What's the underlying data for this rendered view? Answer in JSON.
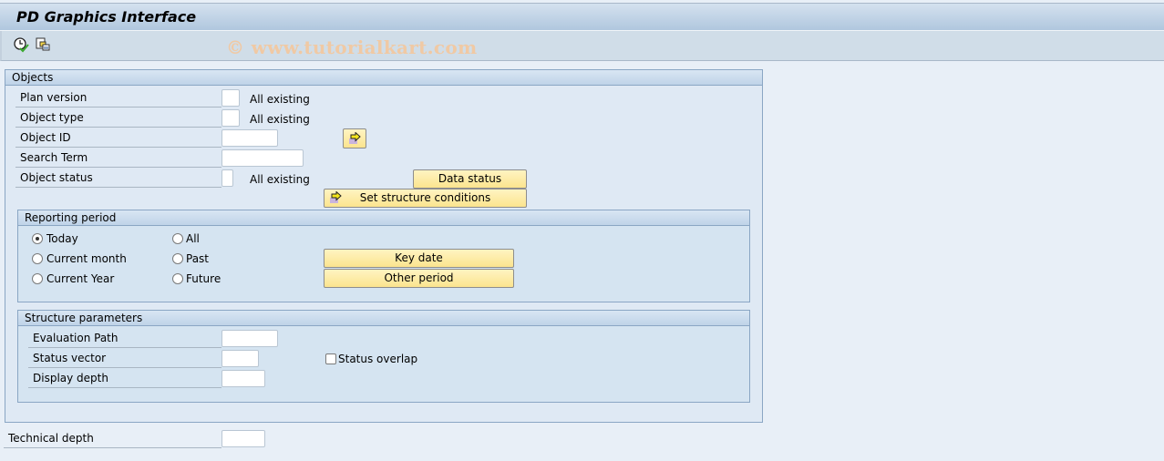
{
  "window": {
    "title": "PD Graphics Interface",
    "watermark": "© www.tutorialkart.com"
  },
  "toolbar": {
    "icons": [
      {
        "name": "execute-clock-icon",
        "tooltip": ""
      },
      {
        "name": "copy-objects-icon",
        "tooltip": ""
      }
    ]
  },
  "objects": {
    "title": "Objects",
    "fields": [
      {
        "label": "Plan version",
        "value": "",
        "text": "All existing"
      },
      {
        "label": "Object type",
        "value": "",
        "text": "All existing"
      },
      {
        "label": "Object ID",
        "value": ""
      },
      {
        "label": "Search Term",
        "value": ""
      },
      {
        "label": "Object status",
        "value": "",
        "text": "All existing"
      }
    ],
    "buttons": {
      "data_status": "Data status",
      "set_structure_conditions": "Set structure conditions"
    }
  },
  "reporting_period": {
    "title": "Reporting period",
    "options": [
      {
        "label": "Today",
        "selected": true
      },
      {
        "label": "Current month",
        "selected": false
      },
      {
        "label": "Current Year",
        "selected": false
      },
      {
        "label": "All",
        "selected": false
      },
      {
        "label": "Past",
        "selected": false
      },
      {
        "label": "Future",
        "selected": false
      }
    ],
    "buttons": {
      "key_date": "Key date",
      "other_period": "Other period"
    }
  },
  "structure_parameters": {
    "title": "Structure parameters",
    "fields": [
      {
        "label": "Evaluation Path",
        "value": ""
      },
      {
        "label": "Status vector",
        "value": ""
      },
      {
        "label": "Display depth",
        "value": ""
      }
    ],
    "status_overlap": {
      "label": "Status overlap",
      "checked": false
    }
  },
  "technical_depth": {
    "label": "Technical depth",
    "value": ""
  }
}
